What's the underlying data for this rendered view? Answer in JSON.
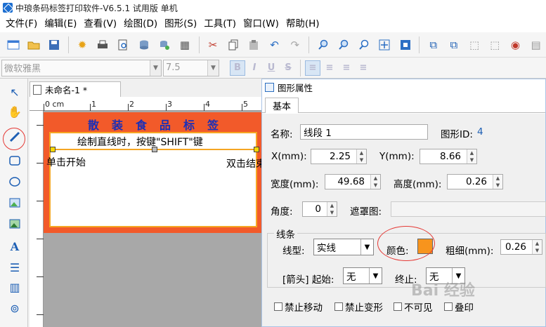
{
  "window": {
    "title": "中琅条码标签打印软件-V6.5.1 试用版 单机"
  },
  "menu": [
    {
      "label": "文件(F)"
    },
    {
      "label": "编辑(E)"
    },
    {
      "label": "查看(V)"
    },
    {
      "label": "绘图(D)"
    },
    {
      "label": "图形(S)"
    },
    {
      "label": "工具(T)"
    },
    {
      "label": "窗口(W)"
    },
    {
      "label": "帮助(H)"
    }
  ],
  "format_toolbar": {
    "font": "微软雅黑",
    "size": "7.5",
    "bold": "B",
    "italic": "I",
    "underline": "U",
    "strike": "S"
  },
  "document": {
    "tab": "未命名-1 *"
  },
  "label": {
    "header": "散装食品标签",
    "hint_line": "绘制直线时，按键\"SHIFT\"键",
    "start_hint": "单击开始",
    "end_hint": "双击结束"
  },
  "ruler": {
    "unit": "0 cm",
    "marks": [
      "1",
      "2",
      "3",
      "4",
      "5"
    ]
  },
  "dialog": {
    "title": "图形属性",
    "tab": "基本",
    "name_label": "名称:",
    "name_value": "线段 1",
    "id_label": "图形ID:",
    "id_value": "4",
    "x_label": "X(mm):",
    "x_value": "2.25",
    "y_label": "Y(mm):",
    "y_value": "8.66",
    "width_label": "宽度(mm):",
    "width_value": "49.68",
    "height_label": "高度(mm):",
    "height_value": "0.26",
    "angle_label": "角度:",
    "angle_value": "0",
    "mask_label": "遮罩图:",
    "line_group": "线条",
    "line_type_label": "线型:",
    "line_type_value": "实线",
    "color_label": "颜色:",
    "color_value": "#f7941d",
    "thickness_label": "粗细(mm):",
    "thickness_value": "0.26",
    "arrow_label": "[箭头] 起始:",
    "arrow_start_value": "无",
    "arrow_end_label": "终止:",
    "arrow_end_value": "无",
    "checks": [
      {
        "label": "禁止移动"
      },
      {
        "label": "禁止变形"
      },
      {
        "label": "不可见"
      },
      {
        "label": "叠印"
      }
    ]
  },
  "watermark": "Bai 经验",
  "colors": {
    "label_border": "#f25a2a",
    "label_header": "#1a2fb8",
    "accent": "#f5a623",
    "annotation": "#e53935"
  }
}
